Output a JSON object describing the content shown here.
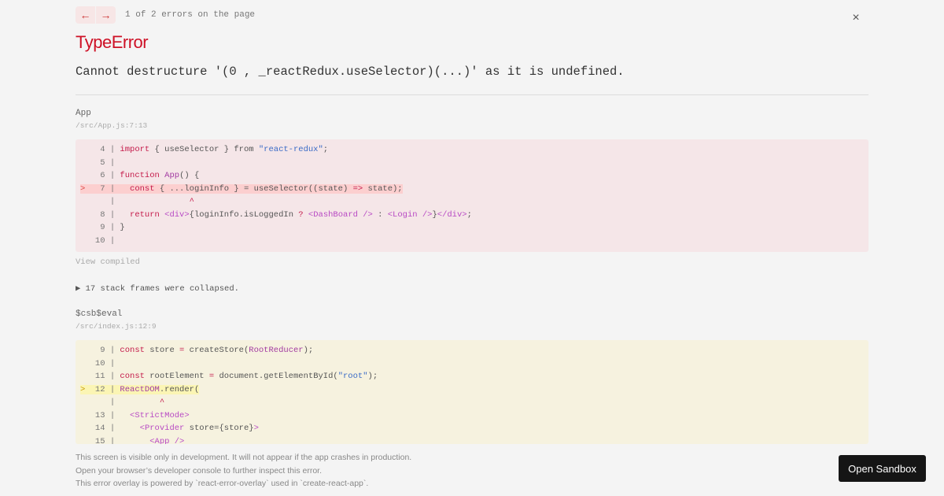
{
  "header": {
    "prev_icon": "←",
    "next_icon": "→",
    "error_count": "1 of 2 errors on the page",
    "close_icon": "×"
  },
  "error": {
    "type": "TypeError",
    "message": "Cannot destructure '(0 , _reactRedux.useSelector)(...)' as it is undefined."
  },
  "frames": [
    {
      "name": "App",
      "file": "/src/App.js:7:13",
      "theme": "red",
      "lines": [
        {
          "marker": "  ",
          "num": " 4",
          "code": [
            {
              "t": "import",
              "c": "kw"
            },
            {
              "t": " { useSelector } from "
            },
            {
              "t": "\"react-redux\"",
              "c": "str"
            },
            {
              "t": ";"
            }
          ]
        },
        {
          "marker": "  ",
          "num": " 5",
          "code": []
        },
        {
          "marker": "  ",
          "num": " 6",
          "code": [
            {
              "t": "function",
              "c": "kw"
            },
            {
              "t": " "
            },
            {
              "t": "App",
              "c": "fn"
            },
            {
              "t": "() {"
            }
          ]
        },
        {
          "marker": "> ",
          "num": " 7",
          "highlight": true,
          "code": [
            {
              "t": "  "
            },
            {
              "t": "const",
              "c": "kw"
            },
            {
              "t": " { ...loginInfo } = useSelector((state) "
            },
            {
              "t": "=>",
              "c": "kw"
            },
            {
              "t": " state);"
            }
          ]
        },
        {
          "marker": "  ",
          "num": "  ",
          "code": [
            {
              "t": "              "
            },
            {
              "t": "^",
              "c": "kw"
            }
          ]
        },
        {
          "marker": "  ",
          "num": " 8",
          "code": [
            {
              "t": "  "
            },
            {
              "t": "return",
              "c": "kw"
            },
            {
              "t": " "
            },
            {
              "t": "<div>",
              "c": "tag"
            },
            {
              "t": "{loginInfo.isLoggedIn "
            },
            {
              "t": "?",
              "c": "kw"
            },
            {
              "t": " "
            },
            {
              "t": "<DashBoard />",
              "c": "tag"
            },
            {
              "t": " : "
            },
            {
              "t": "<Login />",
              "c": "tag"
            },
            {
              "t": "}"
            },
            {
              "t": "</div>",
              "c": "tag"
            },
            {
              "t": ";"
            }
          ]
        },
        {
          "marker": "  ",
          "num": " 9",
          "code": [
            {
              "t": "}"
            }
          ]
        },
        {
          "marker": "  ",
          "num": "10",
          "code": []
        }
      ]
    },
    {
      "name": "$csb$eval",
      "file": "/src/index.js:12:9",
      "theme": "yellow",
      "lines": [
        {
          "marker": "  ",
          "num": " 9",
          "code": [
            {
              "t": "const",
              "c": "kw"
            },
            {
              "t": " store "
            },
            {
              "t": "=",
              "c": "kw"
            },
            {
              "t": " createStore("
            },
            {
              "t": "RootReducer",
              "c": "fn"
            },
            {
              "t": ");"
            }
          ]
        },
        {
          "marker": "  ",
          "num": "10",
          "code": []
        },
        {
          "marker": "  ",
          "num": "11",
          "code": [
            {
              "t": "const",
              "c": "kw"
            },
            {
              "t": " rootElement "
            },
            {
              "t": "=",
              "c": "kw"
            },
            {
              "t": " document.getElementById("
            },
            {
              "t": "\"root\"",
              "c": "str"
            },
            {
              "t": ");"
            }
          ]
        },
        {
          "marker": "> ",
          "num": "12",
          "highlight": true,
          "code": [
            {
              "t": "ReactDOM",
              "c": "fn"
            },
            {
              "t": ".render("
            }
          ]
        },
        {
          "marker": "  ",
          "num": "  ",
          "code": [
            {
              "t": "        "
            },
            {
              "t": "^",
              "c": "kw"
            }
          ]
        },
        {
          "marker": "  ",
          "num": "13",
          "code": [
            {
              "t": "  "
            },
            {
              "t": "<StrictMode>",
              "c": "tag"
            }
          ]
        },
        {
          "marker": "  ",
          "num": "14",
          "code": [
            {
              "t": "    "
            },
            {
              "t": "<Provider",
              "c": "tag"
            },
            {
              "t": " store={store}"
            },
            {
              "t": ">",
              "c": "tag"
            }
          ]
        },
        {
          "marker": "  ",
          "num": "15",
          "code": [
            {
              "t": "      "
            },
            {
              "t": "<App />",
              "c": "tag"
            }
          ]
        }
      ]
    }
  ],
  "view_compiled": "View compiled",
  "collapsed_frames": "▶ 17 stack frames were collapsed.",
  "footer": {
    "line1": "This screen is visible only in development. It will not appear if the app crashes in production.",
    "line2": "Open your browser’s developer console to further inspect this error.",
    "line3": "This error overlay is powered by `react-error-overlay` used in `create-react-app`."
  },
  "open_sandbox_label": "Open Sandbox"
}
